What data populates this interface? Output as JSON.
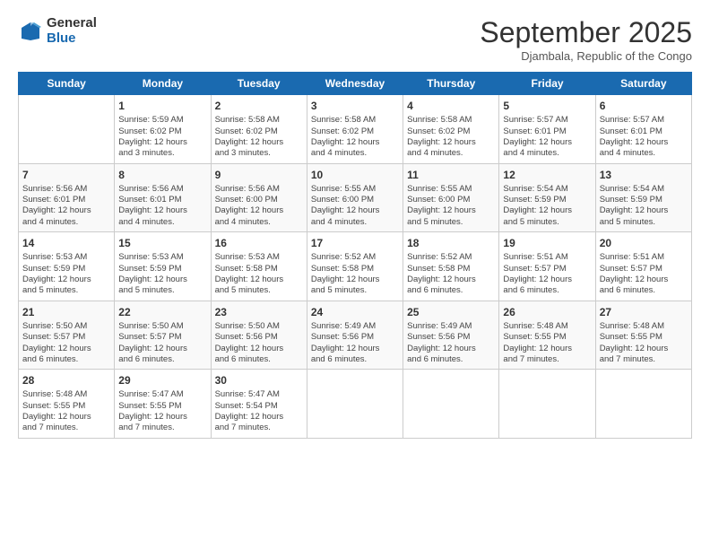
{
  "logo": {
    "general": "General",
    "blue": "Blue"
  },
  "title": "September 2025",
  "subtitle": "Djambala, Republic of the Congo",
  "days_header": [
    "Sunday",
    "Monday",
    "Tuesday",
    "Wednesday",
    "Thursday",
    "Friday",
    "Saturday"
  ],
  "weeks": [
    [
      {
        "day": "",
        "info": ""
      },
      {
        "day": "1",
        "info": "Sunrise: 5:59 AM\nSunset: 6:02 PM\nDaylight: 12 hours\nand 3 minutes."
      },
      {
        "day": "2",
        "info": "Sunrise: 5:58 AM\nSunset: 6:02 PM\nDaylight: 12 hours\nand 3 minutes."
      },
      {
        "day": "3",
        "info": "Sunrise: 5:58 AM\nSunset: 6:02 PM\nDaylight: 12 hours\nand 4 minutes."
      },
      {
        "day": "4",
        "info": "Sunrise: 5:58 AM\nSunset: 6:02 PM\nDaylight: 12 hours\nand 4 minutes."
      },
      {
        "day": "5",
        "info": "Sunrise: 5:57 AM\nSunset: 6:01 PM\nDaylight: 12 hours\nand 4 minutes."
      },
      {
        "day": "6",
        "info": "Sunrise: 5:57 AM\nSunset: 6:01 PM\nDaylight: 12 hours\nand 4 minutes."
      }
    ],
    [
      {
        "day": "7",
        "info": "Sunrise: 5:56 AM\nSunset: 6:01 PM\nDaylight: 12 hours\nand 4 minutes."
      },
      {
        "day": "8",
        "info": "Sunrise: 5:56 AM\nSunset: 6:01 PM\nDaylight: 12 hours\nand 4 minutes."
      },
      {
        "day": "9",
        "info": "Sunrise: 5:56 AM\nSunset: 6:00 PM\nDaylight: 12 hours\nand 4 minutes."
      },
      {
        "day": "10",
        "info": "Sunrise: 5:55 AM\nSunset: 6:00 PM\nDaylight: 12 hours\nand 4 minutes."
      },
      {
        "day": "11",
        "info": "Sunrise: 5:55 AM\nSunset: 6:00 PM\nDaylight: 12 hours\nand 5 minutes."
      },
      {
        "day": "12",
        "info": "Sunrise: 5:54 AM\nSunset: 5:59 PM\nDaylight: 12 hours\nand 5 minutes."
      },
      {
        "day": "13",
        "info": "Sunrise: 5:54 AM\nSunset: 5:59 PM\nDaylight: 12 hours\nand 5 minutes."
      }
    ],
    [
      {
        "day": "14",
        "info": "Sunrise: 5:53 AM\nSunset: 5:59 PM\nDaylight: 12 hours\nand 5 minutes."
      },
      {
        "day": "15",
        "info": "Sunrise: 5:53 AM\nSunset: 5:59 PM\nDaylight: 12 hours\nand 5 minutes."
      },
      {
        "day": "16",
        "info": "Sunrise: 5:53 AM\nSunset: 5:58 PM\nDaylight: 12 hours\nand 5 minutes."
      },
      {
        "day": "17",
        "info": "Sunrise: 5:52 AM\nSunset: 5:58 PM\nDaylight: 12 hours\nand 5 minutes."
      },
      {
        "day": "18",
        "info": "Sunrise: 5:52 AM\nSunset: 5:58 PM\nDaylight: 12 hours\nand 6 minutes."
      },
      {
        "day": "19",
        "info": "Sunrise: 5:51 AM\nSunset: 5:57 PM\nDaylight: 12 hours\nand 6 minutes."
      },
      {
        "day": "20",
        "info": "Sunrise: 5:51 AM\nSunset: 5:57 PM\nDaylight: 12 hours\nand 6 minutes."
      }
    ],
    [
      {
        "day": "21",
        "info": "Sunrise: 5:50 AM\nSunset: 5:57 PM\nDaylight: 12 hours\nand 6 minutes."
      },
      {
        "day": "22",
        "info": "Sunrise: 5:50 AM\nSunset: 5:57 PM\nDaylight: 12 hours\nand 6 minutes."
      },
      {
        "day": "23",
        "info": "Sunrise: 5:50 AM\nSunset: 5:56 PM\nDaylight: 12 hours\nand 6 minutes."
      },
      {
        "day": "24",
        "info": "Sunrise: 5:49 AM\nSunset: 5:56 PM\nDaylight: 12 hours\nand 6 minutes."
      },
      {
        "day": "25",
        "info": "Sunrise: 5:49 AM\nSunset: 5:56 PM\nDaylight: 12 hours\nand 6 minutes."
      },
      {
        "day": "26",
        "info": "Sunrise: 5:48 AM\nSunset: 5:55 PM\nDaylight: 12 hours\nand 7 minutes."
      },
      {
        "day": "27",
        "info": "Sunrise: 5:48 AM\nSunset: 5:55 PM\nDaylight: 12 hours\nand 7 minutes."
      }
    ],
    [
      {
        "day": "28",
        "info": "Sunrise: 5:48 AM\nSunset: 5:55 PM\nDaylight: 12 hours\nand 7 minutes."
      },
      {
        "day": "29",
        "info": "Sunrise: 5:47 AM\nSunset: 5:55 PM\nDaylight: 12 hours\nand 7 minutes."
      },
      {
        "day": "30",
        "info": "Sunrise: 5:47 AM\nSunset: 5:54 PM\nDaylight: 12 hours\nand 7 minutes."
      },
      {
        "day": "",
        "info": ""
      },
      {
        "day": "",
        "info": ""
      },
      {
        "day": "",
        "info": ""
      },
      {
        "day": "",
        "info": ""
      }
    ]
  ]
}
